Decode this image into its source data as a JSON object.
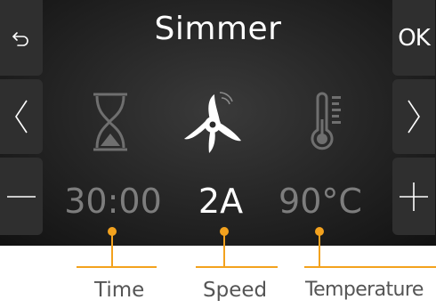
{
  "screen": {
    "title": "Simmer",
    "left_buttons": [
      {
        "name": "back-button",
        "icon": "back-arrow-icon"
      },
      {
        "name": "previous-button",
        "icon": "chevron-left-icon"
      },
      {
        "name": "decrease-button",
        "icon": "minus-icon"
      }
    ],
    "right_buttons": [
      {
        "name": "ok-button",
        "label": "OK"
      },
      {
        "name": "next-button",
        "icon": "chevron-right-icon"
      },
      {
        "name": "increase-button",
        "icon": "plus-icon"
      }
    ],
    "parameters": {
      "time": {
        "value": "30:00",
        "icon": "hourglass-icon",
        "active": false
      },
      "speed": {
        "value": "2A",
        "icon": "blade-icon",
        "active": true
      },
      "temperature": {
        "value": "90°C",
        "icon": "thermometer-icon",
        "active": false
      }
    }
  },
  "annotations": {
    "time_label": "Time",
    "speed_label": "Speed",
    "temperature_label": "Temperature",
    "accent_color": "#f3a21e"
  },
  "colors": {
    "active_text": "#ffffff",
    "inactive_text": "#7d7d7d",
    "button_bg": "#2f2f2f"
  }
}
